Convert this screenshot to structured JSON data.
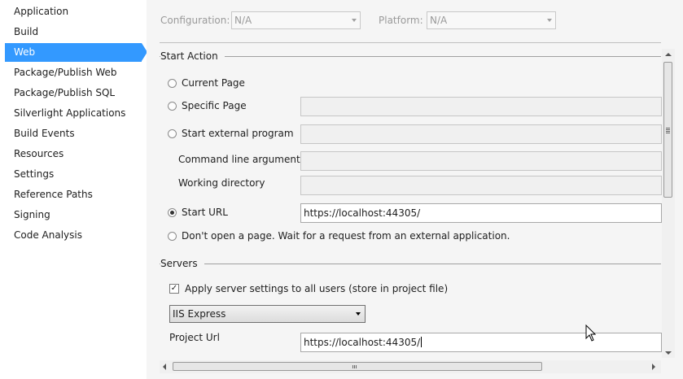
{
  "sidebar": {
    "items": [
      {
        "label": "Application"
      },
      {
        "label": "Build"
      },
      {
        "label": "Web",
        "active": true
      },
      {
        "label": "Package/Publish Web"
      },
      {
        "label": "Package/Publish SQL"
      },
      {
        "label": "Silverlight Applications"
      },
      {
        "label": "Build Events"
      },
      {
        "label": "Resources"
      },
      {
        "label": "Settings"
      },
      {
        "label": "Reference Paths"
      },
      {
        "label": "Signing"
      },
      {
        "label": "Code Analysis"
      }
    ]
  },
  "top": {
    "configuration_label": "Configuration:",
    "configuration_value": "N/A",
    "platform_label": "Platform:",
    "platform_value": "N/A"
  },
  "start_action": {
    "title": "Start Action",
    "current_page": "Current Page",
    "specific_page": "Specific Page",
    "start_external": "Start external program",
    "cmd_args": "Command line arguments",
    "working_dir": "Working directory",
    "start_url": "Start URL",
    "start_url_value": "https://localhost:44305/",
    "dont_open": "Don't open a page.  Wait for a request from an external application.",
    "selected": "Start URL"
  },
  "servers": {
    "title": "Servers",
    "apply_all": "Apply server settings to all users (store in project file)",
    "apply_all_checked": true,
    "server_type": "IIS Express",
    "project_url_label": "Project Url",
    "project_url_value": "https://localhost:44305/"
  },
  "colors": {
    "accent": "#3399ff",
    "panel_bg": "#f5f5f5"
  }
}
